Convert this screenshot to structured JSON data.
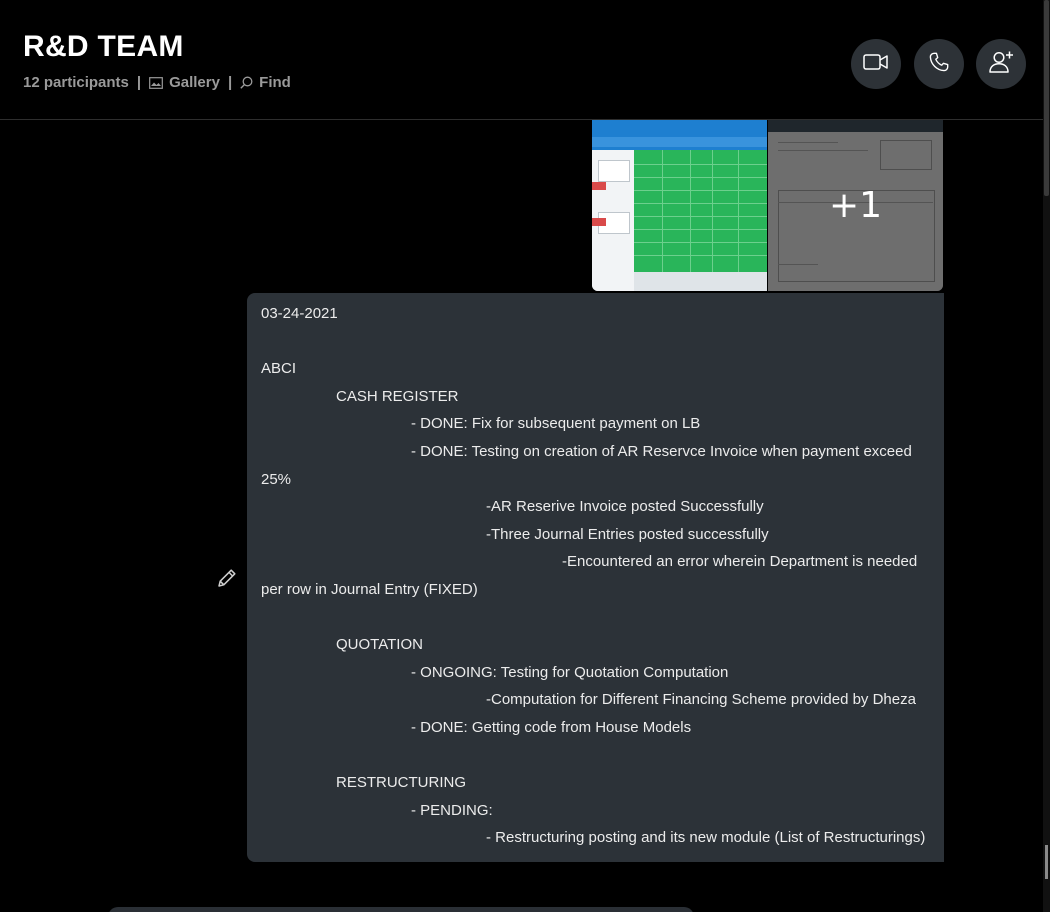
{
  "header": {
    "title": "R&D TEAM",
    "participants": "12 participants",
    "separator": "|",
    "gallery_label": "Gallery",
    "find_label": "Find"
  },
  "attachments": {
    "more_count": "+1"
  },
  "message": {
    "date": "03-24-2021",
    "company": "ABCI",
    "sections": {
      "cash_register": {
        "title": "CASH REGISTER",
        "item1": "- DONE: Fix for subsequent payment on LB",
        "item2": "- DONE: Testing on creation of AR Reservce Invoice when payment exceed",
        "item2_wrap": "25%",
        "sub1": "-AR Reserive Invoice posted Successfully",
        "sub2": "-Three Journal Entries posted successfully",
        "sub3": "-Encountered an error wherein Department is needed",
        "sub3_wrap": "per row in Journal Entry (FIXED)"
      },
      "quotation": {
        "title": "QUOTATION",
        "item1": "- ONGOING: Testing for Quotation Computation",
        "sub1": "-Computation for Different Financing Scheme provided by Dheza",
        "item2": "- DONE: Getting code from House Models"
      },
      "restructuring": {
        "title": "RESTRUCTURING",
        "item1": "- PENDING:",
        "sub1": "- Restructuring posting and its new module (List of Restructurings)"
      }
    }
  },
  "icons": {
    "video": "video-camera-icon",
    "call": "phone-icon",
    "add_person": "add-person-icon",
    "gallery": "gallery-icon",
    "find": "search-icon",
    "edit": "pencil-icon"
  },
  "colors": {
    "background": "#000000",
    "bubble": "#2c3238",
    "header_button": "#2d3237",
    "meta_text": "#9a9a9a"
  }
}
